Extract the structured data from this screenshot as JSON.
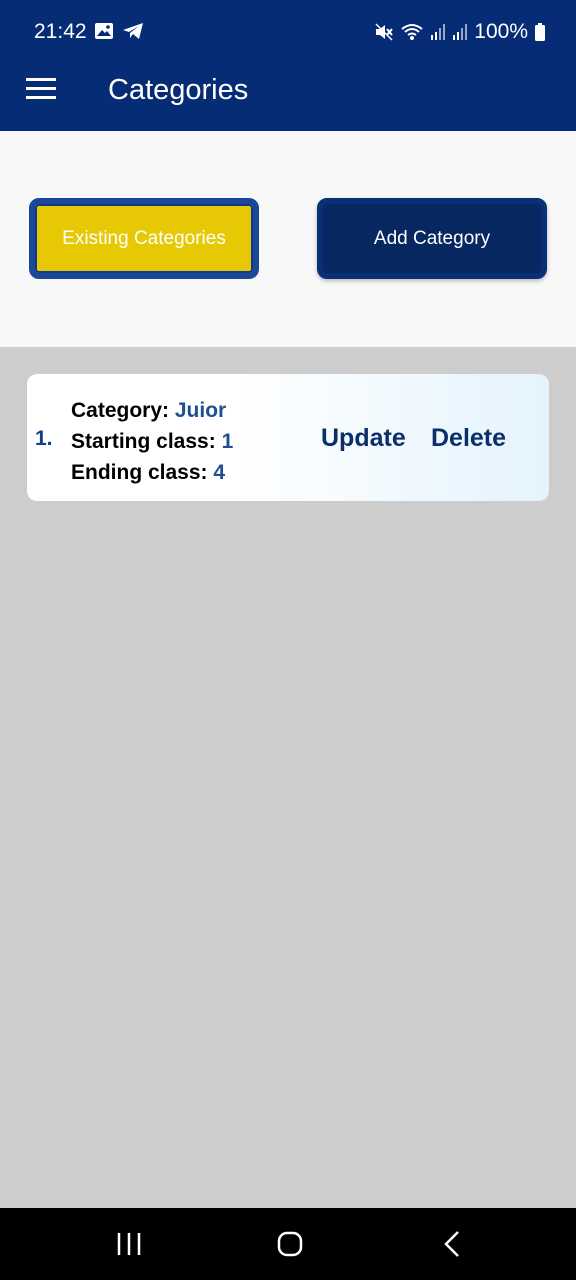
{
  "status_bar": {
    "time": "21:42",
    "battery": "100%",
    "left_icons": [
      "image-icon",
      "telegram-icon"
    ],
    "right_icons": [
      "mute-icon",
      "wifi-icon",
      "signal-icon",
      "signal-icon",
      "battery-icon"
    ]
  },
  "app_bar": {
    "menu_icon": "menu-icon",
    "title": "Categories"
  },
  "buttons": {
    "existing": "Existing Categories",
    "add": "Add Category"
  },
  "categories": [
    {
      "index": "1.",
      "category_label": "Category:",
      "category_value": "Juior",
      "start_label": "Starting class:",
      "start_value": "1",
      "end_label": "Ending class:",
      "end_value": "4",
      "update_label": "Update",
      "delete_label": "Delete"
    }
  ],
  "colors": {
    "primary": "#062c75",
    "accent": "#e6c804",
    "background": "#cdcdcd"
  },
  "nav_bar": {
    "icons": [
      "recent-apps-icon",
      "home-icon",
      "back-icon"
    ]
  }
}
